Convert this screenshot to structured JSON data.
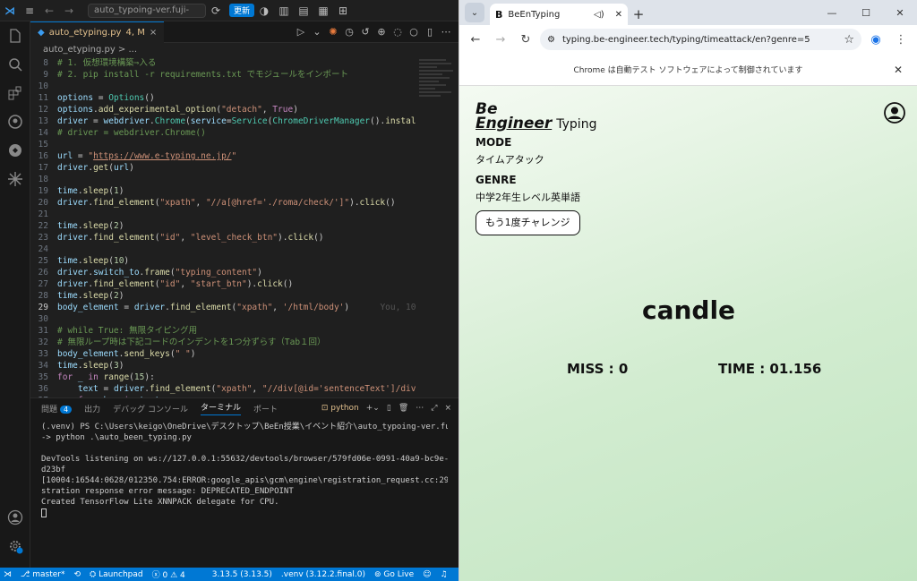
{
  "vscode": {
    "command_center": "auto_typoing-ver.fuji-",
    "update_label": "更新",
    "tab": {
      "name": "auto_etyping.py",
      "status": "4, M"
    },
    "breadcrumb": "auto_etyping.py > ...",
    "code_lines": [
      {
        "n": "8",
        "html": "<span class='cm'># 1. 仮想環境構築⇒入る</span>"
      },
      {
        "n": "9",
        "html": "<span class='cm'># 2. pip install -r requirements.txt でモジュールをインポート</span>"
      },
      {
        "n": "10",
        "html": ""
      },
      {
        "n": "11",
        "html": "<span class='id'>options</span> = <span class='cl'>Options</span>()"
      },
      {
        "n": "12",
        "html": "<span class='id'>options</span>.<span class='fn'>add_experimental_option</span>(<span class='st'>\"detach\"</span>, <span class='kw'>True</span>)"
      },
      {
        "n": "13",
        "html": "<span class='id'>driver</span> = <span class='id'>webdriver</span>.<span class='cl'>Chrome</span>(<span class='id'>service</span>=<span class='cl'>Service</span>(<span class='cl'>ChromeDriverManager</span>().<span class='fn'>install</span>()<span class='ghost'>, optio</span>"
      },
      {
        "n": "14",
        "html": "<span class='cm'># driver = webdriver.Chrome()</span>"
      },
      {
        "n": "15",
        "html": ""
      },
      {
        "n": "16",
        "html": "<span class='id'>url</span> = <span class='st'>\"<u>https://www.e-typing.ne.jp/</u>\"</span>"
      },
      {
        "n": "17",
        "html": "<span class='id'>driver</span>.<span class='fn'>get</span>(<span class='id'>url</span>)"
      },
      {
        "n": "18",
        "html": ""
      },
      {
        "n": "19",
        "html": "<span class='id'>time</span>.<span class='fn'>sleep</span>(<span class='nb'>1</span>)"
      },
      {
        "n": "20",
        "html": "<span class='id'>driver</span>.<span class='fn'>find_element</span>(<span class='st'>\"xpath\"</span>, <span class='st'>\"//a[@href='./roma/check/']\"</span>).<span class='fn'>click</span>()"
      },
      {
        "n": "21",
        "html": ""
      },
      {
        "n": "22",
        "html": "<span class='id'>time</span>.<span class='fn'>sleep</span>(<span class='nb'>2</span>)"
      },
      {
        "n": "23",
        "html": "<span class='id'>driver</span>.<span class='fn'>find_element</span>(<span class='st'>\"id\"</span>, <span class='st'>\"level_check_btn\"</span>).<span class='fn'>click</span>()"
      },
      {
        "n": "24",
        "html": ""
      },
      {
        "n": "25",
        "html": "<span class='id'>time</span>.<span class='fn'>sleep</span>(<span class='nb'>10</span>)"
      },
      {
        "n": "26",
        "html": "<span class='id'>driver</span>.<span class='id'>switch_to</span>.<span class='fn'>frame</span>(<span class='st'>\"typing_content\"</span>)"
      },
      {
        "n": "27",
        "html": "<span class='id'>driver</span>.<span class='fn'>find_element</span>(<span class='st'>\"id\"</span>, <span class='st'>\"start_btn\"</span>).<span class='fn'>click</span>()"
      },
      {
        "n": "28",
        "html": "<span class='id'>time</span>.<span class='fn'>sleep</span>(<span class='nb'>2</span>)"
      },
      {
        "n": "29",
        "html": "<span class='id'>body_element</span> = <span class='id'>driver</span>.<span class='fn'>find_element</span>(<span class='st'>\"xpath\"</span>, <span class='st'>'/html/body'</span>)      <span class='ghost'>You, 10 か</span>"
      },
      {
        "n": "30",
        "html": ""
      },
      {
        "n": "31",
        "html": "<span class='cm'># while True: 無限タイピング用</span>"
      },
      {
        "n": "32",
        "html": "<span class='cm'># 無限ループ時は下記コードのインデントを1つ分ずらす（Tab１回）</span>"
      },
      {
        "n": "33",
        "html": "<span class='id'>body_element</span>.<span class='fn'>send_keys</span>(<span class='st'>\" \"</span>)"
      },
      {
        "n": "34",
        "html": "<span class='id'>time</span>.<span class='fn'>sleep</span>(<span class='nb'>3</span>)"
      },
      {
        "n": "35",
        "html": "<span class='kw'>for</span> <span class='id'>_</span> <span class='kw'>in</span> <span class='fn'>range</span>(<span class='nb'>15</span>):"
      },
      {
        "n": "36",
        "html": "    <span class='id'>text</span> = <span class='id'>driver</span>.<span class='fn'>find_element</span>(<span class='st'>\"xpath\"</span>, <span class='st'>\"//div[@id='sentenceText']/div/spa</span><span class='ghost'>n[cla</span>"
      },
      {
        "n": "37",
        "html": "    <span class='kw'>for</span> <span class='id'>char</span> <span class='kw'>in</span> <span class='id'>text</span>:"
      }
    ],
    "current_line": "29",
    "panel_tabs": [
      "問題",
      "出力",
      "デバッグ コンソール",
      "ターミナル",
      "ポート"
    ],
    "problems_count": "4",
    "terminal_name": "python",
    "terminal_lines": [
      "(.venv) PS C:\\Users\\keigo\\OneDrive\\デスクトップ\\BeEn授業\\イベント紹介\\auto_typoing-ver.fuji",
      "-> python .\\auto_been_typing.py",
      "",
      "DevTools listening on ws://127.0.0.1:55632/devtools/browser/579fd06e-0991-40a9-bc9e-62bccd3",
      "d23bf",
      "[10004:16544:0628/012350.754:ERROR:google_apis\\gcm\\engine\\registration_request.cc:291] Regi",
      "stration response error message: DEPRECATED_ENDPOINT",
      "Created TensorFlow Lite XNNPACK delegate for CPU."
    ],
    "status": {
      "branch": "master*",
      "launchpad": "Launchpad",
      "errors": "0",
      "warnings": "4",
      "python_version": "3.13.5 (3.13.5)",
      "venv": ".venv (3.12.2.final.0)",
      "golive": "Go Live"
    }
  },
  "chrome": {
    "tab_title": "BeEnTyping",
    "url": "typing.be-engineer.tech/typing/timeattack/en?genre=5",
    "infobar": "Chrome は自動テスト ソフトウェアによって制御されています",
    "logo_be": "Be",
    "logo_engineer": "Engineer",
    "logo_typing": "Typing",
    "mode_label": "MODE",
    "mode_value": "タイムアタック",
    "genre_label": "GENRE",
    "genre_value": "中学2年生レベル英単語",
    "retry_label": "もう1度チャレンジ",
    "word": "candle",
    "miss": "MISS : 0",
    "time": "TIME : 01.156"
  }
}
